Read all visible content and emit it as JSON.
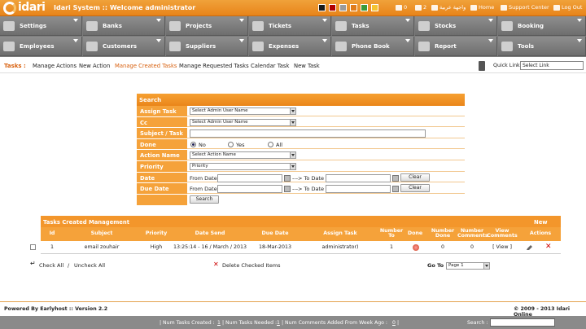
{
  "header": {
    "logo_text": "idari",
    "title": "Idari System :: Welcome administrator",
    "color_swatches": [
      "#1a1a1a",
      "#b00000",
      "#9a9a9a",
      "#e07c1a",
      "#3a9a3a",
      "#f4c430"
    ],
    "counter_1": "0",
    "counter_2": "2",
    "language": "واجهة عربية",
    "home": "Home",
    "support": "Support Center",
    "logout": "Log Out"
  },
  "menu": {
    "row1": [
      "Settings",
      "Banks",
      "Projects",
      "Tickets",
      "Tasks",
      "Stocks",
      "Booking"
    ],
    "row2": [
      "Employees",
      "Customers",
      "Suppliers",
      "Expenses",
      "Phone Book",
      "Report",
      "Tools"
    ]
  },
  "subnav": {
    "label": "Tasks :",
    "links": [
      "Manage Actions",
      "New Action",
      "Manage Created Tasks",
      "Manage Requested Tasks",
      "Calendar Task",
      "New Task"
    ],
    "quick_link_label": "Quick Link",
    "quick_link_value": "Select Link"
  },
  "search": {
    "title": "Search",
    "assign_task_label": "Assign Task",
    "assign_task_value": "Select Admin User Name",
    "cc_label": "Cc",
    "cc_value": "Select Admin User Name",
    "subject_label": "Subject / Task",
    "done_label": "Done",
    "done_options": [
      "No",
      "Yes",
      "All"
    ],
    "action_name_label": "Action Name",
    "action_name_value": "Select Action Name",
    "priority_label": "Priority",
    "priority_value": "Priority",
    "date_label": "Date",
    "due_date_label": "Due Date",
    "from_date": "From Date",
    "to_date": "---> To Date",
    "clear": "Clear",
    "search_button": "Search"
  },
  "table": {
    "title": "Tasks Created Management",
    "new_label": "New",
    "columns": [
      "Id",
      "Subject",
      "Priority",
      "Date Send",
      "Due Date",
      "Assign Task",
      "Number To",
      "Done",
      "Number Done",
      "Number Comments",
      "View Comments",
      "Actions"
    ],
    "rows": [
      {
        "id": "1",
        "subject": "email zouhair",
        "priority": "High",
        "date_send": "13:25:14 - 16 / March / 2013",
        "due_date": "18-Mar-2013",
        "assign_task": "administrator)",
        "number_to": "1",
        "number_done": "0",
        "number_comments": "0",
        "view": "[ View ]"
      }
    ]
  },
  "bulk": {
    "check_all": "Check All",
    "separator": "/",
    "uncheck_all": "Uncheck All",
    "delete_checked": "Delete Checked Items",
    "goto_label": "Go To",
    "page_value": "Page 1"
  },
  "footer": {
    "powered": "Powered By Earlyhost :: Version 2.2",
    "copyright": "© 2009 - 2013 Idari Online",
    "bar_items": [
      "| Num Tasks Created : ",
      "1",
      " | Num Tasks Needed : ",
      "1",
      " | Num Comments Added From Week Ago : ",
      "0",
      " | "
    ],
    "search_label": "Search :"
  }
}
